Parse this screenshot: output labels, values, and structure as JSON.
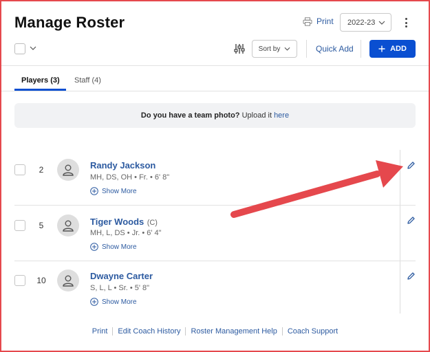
{
  "header": {
    "title": "Manage Roster",
    "print_label": "Print",
    "season": "2022-23",
    "sort_label": "Sort by",
    "quick_add_label": "Quick Add",
    "add_label": "ADD"
  },
  "tabs": [
    {
      "label": "Players (3)",
      "active": true
    },
    {
      "label": "Staff (4)",
      "active": false
    }
  ],
  "banner": {
    "question": "Do you have a team photo?",
    "upload_text": " Upload it ",
    "link_text": "here"
  },
  "players": [
    {
      "number": "2",
      "name": "Randy Jackson",
      "captain": "",
      "meta": "MH, DS, OH • Fr. • 6' 8\"",
      "more_label": "Show More"
    },
    {
      "number": "5",
      "name": "Tiger Woods",
      "captain": "(C)",
      "meta": "MH, L, DS • Jr. • 6' 4\"",
      "more_label": "Show More"
    },
    {
      "number": "10",
      "name": "Dwayne Carter",
      "captain": "",
      "meta": "S, L, L • Sr. • 5' 8\"",
      "more_label": "Show More"
    }
  ],
  "footer": {
    "links": [
      "Print",
      "Edit Coach History",
      "Roster Management Help",
      "Coach Support"
    ]
  },
  "colors": {
    "accent": "#0a4fd1",
    "link": "#2c5aa0",
    "annotation_arrow": "#e5484d"
  },
  "icons": [
    "printer-icon",
    "chevron-down-icon",
    "filter-sliders-icon",
    "plus-icon",
    "kebab-menu-icon",
    "avatar-icon",
    "plus-circle-icon",
    "pencil-icon"
  ]
}
